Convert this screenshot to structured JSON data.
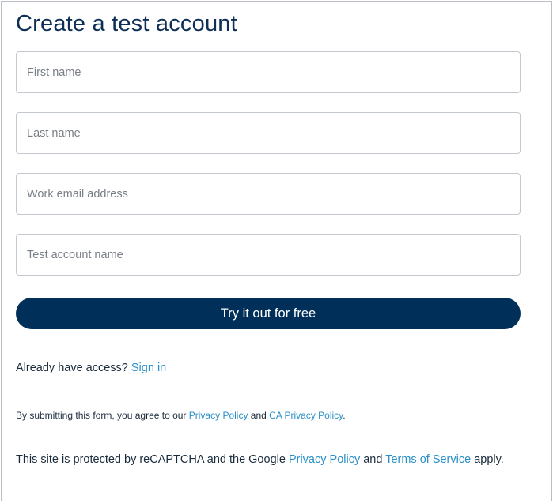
{
  "form": {
    "title": "Create a test account",
    "fields": {
      "first_name": {
        "placeholder": "First name",
        "value": ""
      },
      "last_name": {
        "placeholder": "Last name",
        "value": ""
      },
      "work_email": {
        "placeholder": "Work email address",
        "value": ""
      },
      "account_name": {
        "placeholder": "Test account name",
        "value": ""
      }
    },
    "submit_label": "Try it out for free"
  },
  "access": {
    "text": "Already have access? ",
    "sign_in_label": "Sign in"
  },
  "consent": {
    "prefix": "By submitting this form, you agree to our ",
    "privacy_policy_label": "Privacy Policy",
    "middle": " and ",
    "ca_privacy_policy_label": "CA Privacy Policy",
    "suffix": "."
  },
  "recaptcha": {
    "prefix": "This site is protected by reCAPTCHA and the Google ",
    "privacy_policy_label": "Privacy Policy",
    "middle": " and ",
    "terms_label": "Terms of Service",
    "suffix": " apply."
  },
  "colors": {
    "title": "#0e2f56",
    "button_bg": "#00305a",
    "link": "#2a8fc7",
    "field_border": "#c4c8cf"
  }
}
